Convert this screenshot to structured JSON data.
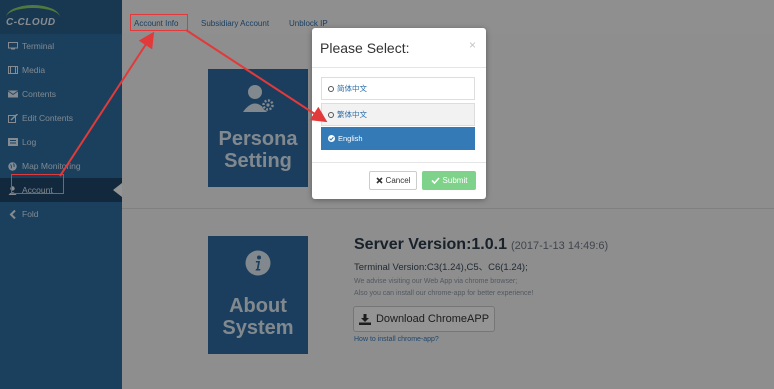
{
  "app": {
    "logo_text": "C-CLOUD"
  },
  "sidebar": {
    "items": [
      {
        "label": "Terminal",
        "icon": "monitor-icon"
      },
      {
        "label": "Media",
        "icon": "film-icon"
      },
      {
        "label": "Contents",
        "icon": "envelope-icon"
      },
      {
        "label": "Edit Contents",
        "icon": "edit-icon"
      },
      {
        "label": "Log",
        "icon": "list-icon"
      },
      {
        "label": "Map Monitoring",
        "icon": "globe-icon"
      },
      {
        "label": "Account",
        "icon": "user-icon",
        "active": true
      },
      {
        "label": "Fold",
        "icon": "chevron-left-icon"
      }
    ]
  },
  "tabs": [
    {
      "label": "Account Info",
      "active": true
    },
    {
      "label": "Subsidiary Account"
    },
    {
      "label": "Unblock IP"
    }
  ],
  "tiles": {
    "personal": {
      "line1": "Persona",
      "line2": "Setting"
    },
    "about": {
      "line1": "About",
      "line2": "System"
    }
  },
  "server": {
    "title": "Server Version:1.0.1",
    "date": "(2017-1-13 14:49:6)",
    "terminal": "Terminal Version:C3(1.24),C5、C6(1.24);",
    "advice1": "We advise visiting our Web App via chrome browser;",
    "advice2": "Also you can install our chrome-app for better experience!",
    "download_label": "Download ChromeAPP",
    "howto_link": "How to install chrome-app?"
  },
  "modal": {
    "title": "Please Select:",
    "close": "×",
    "options": [
      {
        "label": "简体中文",
        "selected": false
      },
      {
        "label": "繁体中文",
        "selected": false
      },
      {
        "label": "English",
        "selected": true
      }
    ],
    "cancel_label": "Cancel",
    "submit_label": "Submit"
  },
  "colors": {
    "sidebar": "#2e6fa3",
    "tile": "#2f6ca2",
    "selected_option": "#337ab7",
    "submit": "#7fd28a",
    "annotation": "#e23a3a"
  }
}
